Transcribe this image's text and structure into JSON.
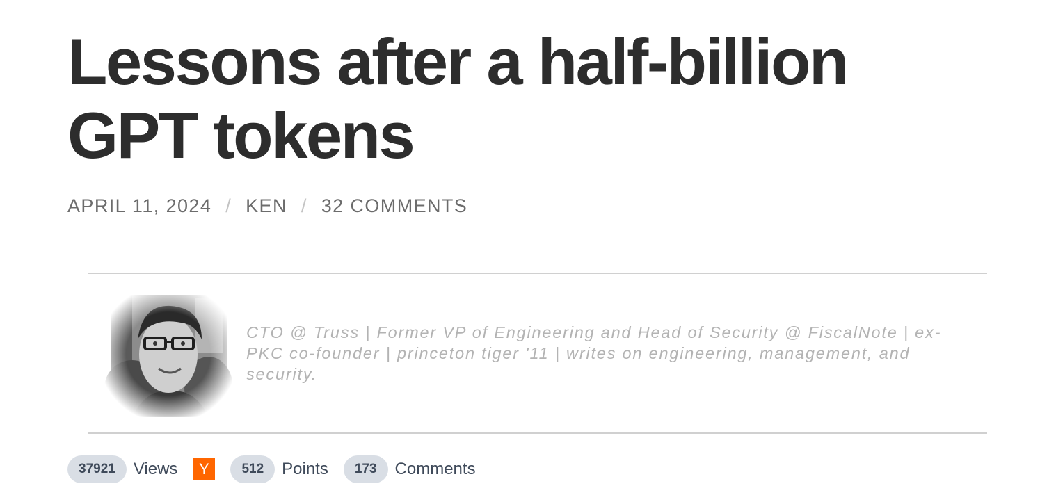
{
  "post": {
    "title": "Lessons after a half-billion GPT tokens",
    "meta": {
      "date": "APRIL 11, 2024",
      "separator": "/",
      "author": "KEN",
      "comments": "32 COMMENTS"
    }
  },
  "author_box": {
    "avatar_icon": "author-portrait",
    "bio": "CTO @ Truss | Former VP of Engineering and Head of Security @ FiscalNote | ex-PKC co-founder | princeton tiger '11 | writes on engineering, management, and security."
  },
  "stats": {
    "views_count": "37921",
    "views_label": "Views",
    "hn_icon": "Y",
    "hn_color": "#ff6600",
    "points_count": "512",
    "points_label": "Points",
    "comments_count": "173",
    "comments_label": "Comments"
  }
}
